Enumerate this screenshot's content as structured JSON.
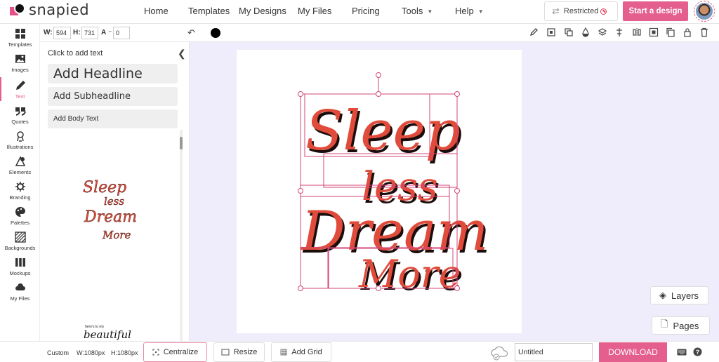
{
  "app": {
    "logo_text": "snapied"
  },
  "nav": {
    "links": [
      "Home",
      "Templates",
      "My Designs",
      "My Files",
      "Pricing",
      "Tools",
      "Help"
    ],
    "restricted_label": "Restricted",
    "start_label": "Start a design"
  },
  "toolbar": {
    "w_label": "W:",
    "w_value": "594",
    "h_label": "H:",
    "h_value": "731",
    "spacing_label": "A",
    "spacing_value": "0",
    "color": "#000000"
  },
  "rail": [
    "Templates",
    "Images",
    "Text",
    "Quotes",
    "Illustrations",
    "Elements",
    "Branding",
    "Palettes",
    "Backgrounds",
    "Mockups",
    "My Files"
  ],
  "panel": {
    "title": "Click to add text",
    "headline": "Add Headline",
    "subheadline": "Add Subheadline",
    "body": "Add Body Text",
    "preview_lines": [
      "Sleep",
      "less",
      "Dream",
      "More"
    ],
    "preview2_small": "here's to my",
    "preview2_big": "beautiful"
  },
  "design": {
    "words": [
      "Sleep",
      "less",
      "Dream",
      "More"
    ],
    "text_color": "#e04b3a",
    "shadow_color": "#1a0a08",
    "selection_color": "#d3467a"
  },
  "side": {
    "layers": "Layers",
    "pages": "Pages"
  },
  "bottom": {
    "size_preset": "Custom",
    "width": "W:1080px",
    "height": "H:1080px",
    "centralize": "Centralize",
    "resize": "Resize",
    "add_grid": "Add Grid",
    "doc_name": "Untitled",
    "download": "DOWNLOAD"
  },
  "colors": {
    "accent": "#e45e8e",
    "canvas_bg": "#efedfb"
  }
}
